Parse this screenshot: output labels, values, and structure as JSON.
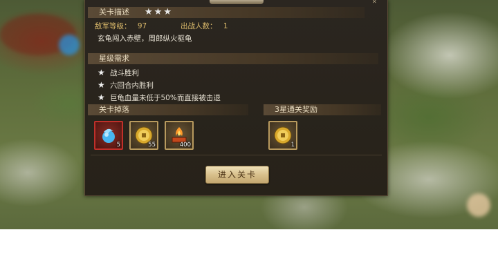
{
  "stage": {
    "title_header": "关卡描述",
    "stars_count": 3,
    "enemy_level_label": "敌军等级：",
    "enemy_level_value": "97",
    "battle_count_label": "出战人数：",
    "battle_count_value": "1",
    "description": "玄龟闯入赤壁，周郎纵火驱龟"
  },
  "requirements": {
    "header": "星级需求",
    "items": [
      "战斗胜利",
      "六回合内胜利",
      "巨龟血量未低于50%而直接被击退"
    ]
  },
  "drops": {
    "header": "关卡掉落",
    "items": [
      {
        "icon": "blue-orb-icon",
        "count": "5"
      },
      {
        "icon": "gold-coin-icon",
        "count": "55"
      },
      {
        "icon": "fire-book-icon",
        "count": "400"
      }
    ]
  },
  "reward": {
    "header": "3星通关奖励",
    "items": [
      {
        "icon": "gold-coin-icon",
        "count": "1"
      }
    ]
  },
  "enter_button": "进入关卡",
  "colors": {
    "panel_bg": "#2b2620",
    "header_text": "#e9dcc0",
    "info_text": "#d9b96a",
    "button_bg": "#d8c08c",
    "drop_highlight_border": "#c0302a"
  }
}
